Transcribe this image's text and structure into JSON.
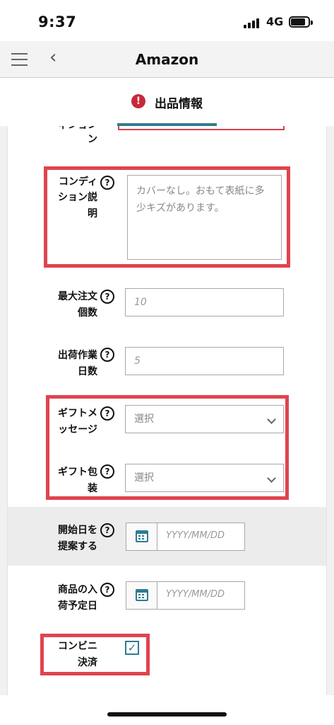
{
  "status": {
    "time": "9:37",
    "network": "4G"
  },
  "nav": {
    "title": "Amazon"
  },
  "tab": {
    "label": "出品情報",
    "alert_glyph": "!"
  },
  "form": {
    "partial_label": [
      "ィション",
      "ン"
    ],
    "condition_note": {
      "label_lines": [
        "コンディ",
        "ション説",
        "明"
      ],
      "placeholder": "カバーなし。おもて表紙に多少キズがあります。"
    },
    "max_order_qty": {
      "label_lines": [
        "最大注文",
        "個数"
      ],
      "placeholder": "10"
    },
    "handling_days": {
      "label_lines": [
        "出荷作業",
        "日数"
      ],
      "placeholder": "5"
    },
    "gift_message": {
      "label_lines": [
        "ギフトメ",
        "ッセージ"
      ],
      "value": "選択"
    },
    "gift_wrap": {
      "label_lines": [
        "ギフト包",
        "装"
      ],
      "value": "選択"
    },
    "start_date": {
      "label_lines": [
        "開始日を",
        "提案する"
      ],
      "placeholder": "YYYY/MM/DD"
    },
    "restock_date": {
      "label_lines": [
        "商品の入",
        "荷予定日"
      ],
      "placeholder": "YYYY/MM/DD"
    },
    "convenience_payment": {
      "label_lines": [
        "コンビニ",
        "決済"
      ],
      "checked": true
    }
  },
  "colors": {
    "accent": "#2f7b92",
    "alert": "#c7293a",
    "annotation": "#e0444e"
  },
  "icons": {
    "menu": "hamburger-icon",
    "back": "chevron-left-icon",
    "help": "question-circle-icon",
    "calendar": "calendar-icon",
    "select": "chevron-down-icon",
    "check": "checkmark-icon"
  }
}
